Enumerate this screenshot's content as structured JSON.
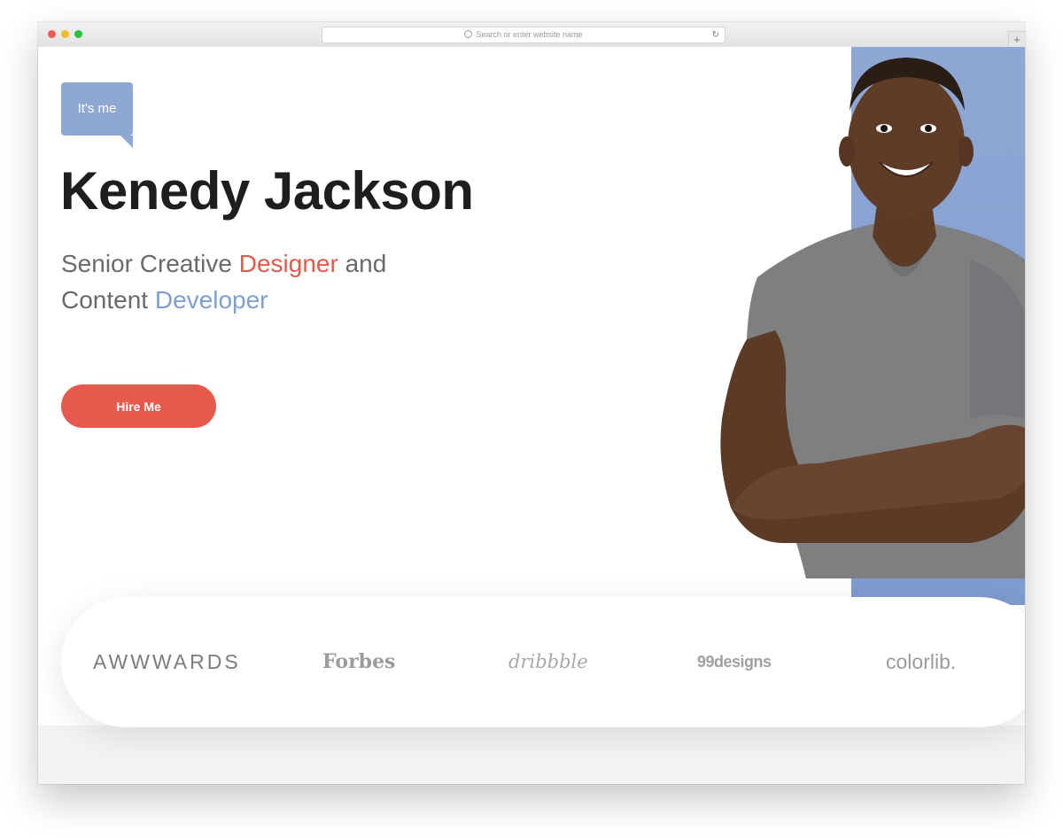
{
  "browser": {
    "address_placeholder": "Search or enter website name",
    "reload_icon": "reload-icon",
    "new_tab_label": "+"
  },
  "hero": {
    "badge": "It's me",
    "name": "Kenedy Jackson",
    "tagline_part1": "Senior Creative ",
    "tagline_highlight1": "Designer",
    "tagline_part2": " and",
    "tagline_part3": "Content ",
    "tagline_highlight2": "Developer",
    "cta_label": "Hire Me"
  },
  "logos": [
    "AWWWARDS",
    "Forbes",
    "dribbble",
    "99designs",
    "colorlib."
  ],
  "colors": {
    "accent_red": "#e55a4c",
    "accent_blue": "#8ea8d3",
    "heading": "#1e1e1e"
  }
}
